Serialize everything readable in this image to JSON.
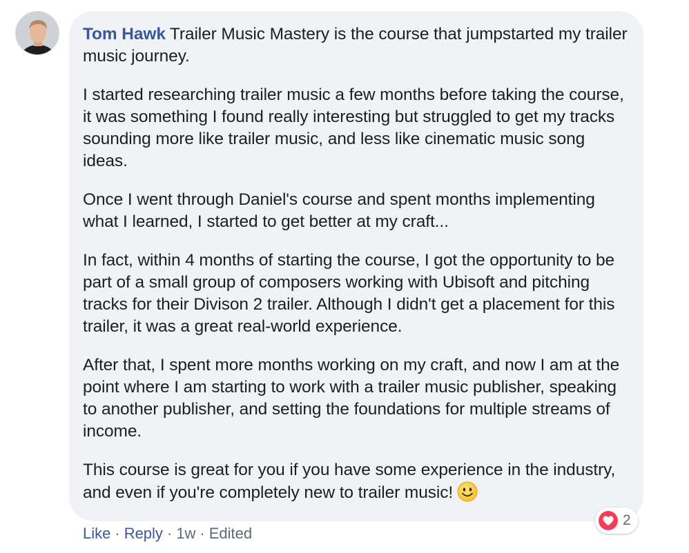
{
  "comment": {
    "author": "Tom Hawk",
    "paragraphs": [
      "Trailer Music Mastery is the course that jumpstarted my trailer music journey.",
      "I started researching trailer music a few months before taking the course, it was something I found really interesting but struggled to get my tracks sounding more like trailer music, and less like cinematic music song ideas.",
      "Once I went through Daniel's course and spent months implementing what I learned, I started to get better at my craft...",
      "In fact, within 4 months of starting the course, I got the opportunity to be part of a small group of composers working with Ubisoft and pitching tracks for their Divison 2 trailer. Although I didn't get a placement for this trailer, it was a great real-world experience.",
      "After that, I spent more months working on my craft, and now I am at the point where I am starting to work with a trailer music publisher, speaking to another publisher, and setting the foundations for multiple streams of income.",
      "This course is great for you if you have some experience in the industry, and even if you're completely new to trailer music!"
    ],
    "emoji_icon": "smiley-emoji-icon"
  },
  "actions": {
    "like_label": "Like",
    "reply_label": "Reply",
    "separator": "·",
    "time": "1w",
    "edited": "Edited"
  },
  "reactions": {
    "icon": "heart-icon",
    "count": "2",
    "color": "#f33e58"
  },
  "colors": {
    "bubble": "#f0f2f5",
    "link": "#385898",
    "text": "#1c1e21",
    "meta": "#606770"
  }
}
